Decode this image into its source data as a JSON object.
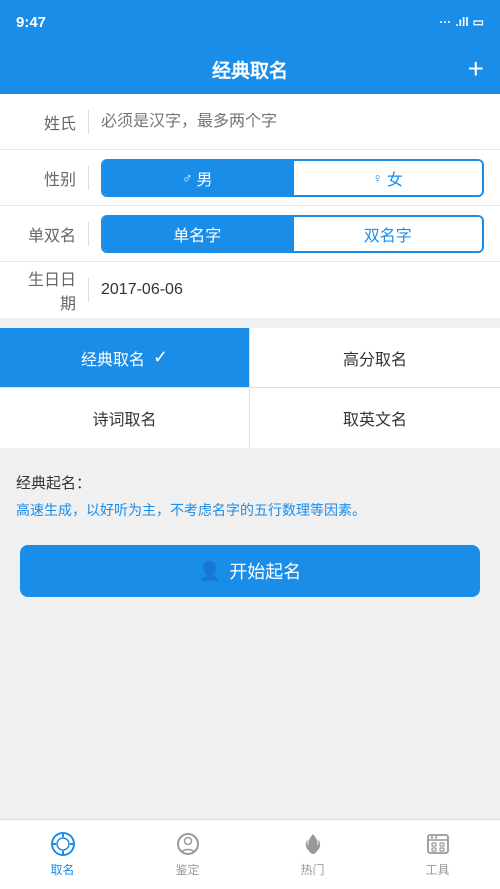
{
  "statusBar": {
    "time": "9:47",
    "icons": "... .ill □"
  },
  "header": {
    "title": "经典取名",
    "plusBtn": "+"
  },
  "form": {
    "surname": {
      "label": "姓氏",
      "placeholder": "必须是汉字，最多两个字"
    },
    "gender": {
      "label": "性别",
      "options": [
        {
          "id": "male",
          "label": "男",
          "icon": "♂",
          "active": true
        },
        {
          "id": "female",
          "label": "女",
          "icon": "♀",
          "active": false
        }
      ]
    },
    "nameType": {
      "label": "单双名",
      "options": [
        {
          "id": "single",
          "label": "单名字",
          "active": true
        },
        {
          "id": "double",
          "label": "双名字",
          "active": false
        }
      ]
    },
    "birthday": {
      "label": "生日日期",
      "value": "2017-06-06"
    }
  },
  "nameModes": [
    {
      "id": "classic",
      "label": "经典取名",
      "active": true,
      "checkmark": "✓"
    },
    {
      "id": "highscore",
      "label": "高分取名",
      "active": false,
      "checkmark": ""
    },
    {
      "id": "poetry",
      "label": "诗词取名",
      "active": false,
      "checkmark": ""
    },
    {
      "id": "english",
      "label": "取英文名",
      "active": false,
      "checkmark": ""
    }
  ],
  "description": {
    "title": "经典起名：",
    "text": "高速生成，以好听为主，不考虑名字的五行数理等因素。"
  },
  "startButton": {
    "label": "开始起名"
  },
  "bottomNav": [
    {
      "id": "naming",
      "label": "取名",
      "active": true
    },
    {
      "id": "appraise",
      "label": "鉴定",
      "active": false
    },
    {
      "id": "hot",
      "label": "热门",
      "active": false
    },
    {
      "id": "tools",
      "label": "工具",
      "active": false
    }
  ]
}
